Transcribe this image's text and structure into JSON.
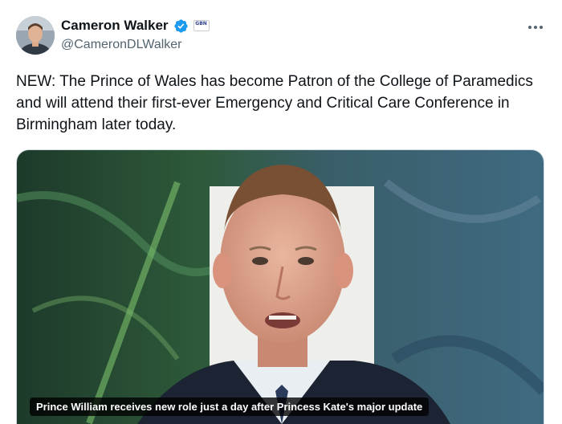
{
  "author": {
    "display_name": "Cameron Walker",
    "handle": "@CameronDLWalker",
    "verified_icon": "verified-badge-icon",
    "affiliate_icon": "affiliate-badge-icon",
    "affiliate_text": "GBN"
  },
  "tweet": {
    "text": "NEW: The Prince of Wales has become Patron of the College of Paramedics and will attend their first-ever Emergency and Critical Care Conference in Birmingham later today."
  },
  "media": {
    "caption": "Prince William receives new role just a day after Princess Kate's major update"
  },
  "colors": {
    "text": "#0f1419",
    "secondary": "#536471",
    "verified": "#1d9bf0"
  }
}
